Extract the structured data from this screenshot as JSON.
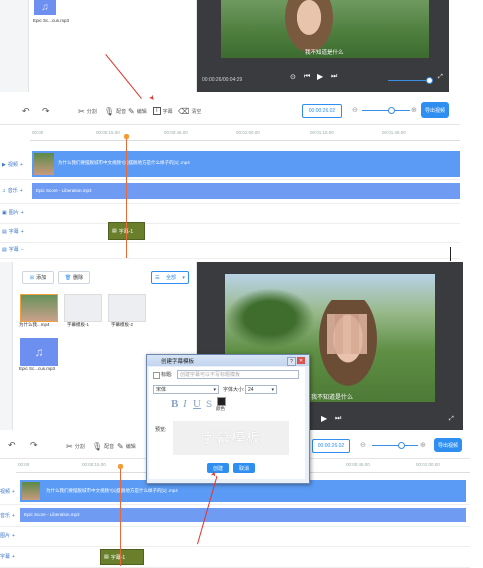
{
  "top": {
    "media_item_label": "Epic Sc...cus.mp3",
    "preview_subtitle": "我不知道是什么",
    "time_display": "00:00:26/00:04:29",
    "toolbar": {
      "split_label": "分割",
      "voice_label": "配音",
      "edit_label": "编辑",
      "subtitle_label": "字幕",
      "clear_label": "清空",
      "time_value": "00:00:26.02",
      "export_label": "导出视频"
    },
    "ruler_ticks": [
      "00:00",
      "00:00:15.00",
      "00:00:45.00",
      "00:01:00.00",
      "00:01:15.00",
      "00:01:45.00"
    ],
    "tracks": {
      "video_label": "视频",
      "music_label": "音乐",
      "image_label": "图片",
      "subtitle_label": "字幕",
      "subtitle2_label": "字幕",
      "video_clip_text": "为什么我们要摆脱城市中文视频?[1]摆脱地方是什么样子的[1] .mp4",
      "audio_clip_text": "Epic Score - Liberation.mp3",
      "subtitle_clip_text": "字幕-1"
    }
  },
  "bottom": {
    "add_label": "添加",
    "delete_label": "删除",
    "filter_label": "全部",
    "media": [
      {
        "label": "为什么我...mp4"
      },
      {
        "label": "字幕模板-1"
      },
      {
        "label": "字幕模板-2"
      },
      {
        "label": "Epic Sc...cus.mp3"
      }
    ],
    "toolbar": {
      "split_label": "分割",
      "voice_label": "配音",
      "edit_label": "编辑",
      "time_value": "00:00:26.02",
      "export_label": "导出视频"
    },
    "ruler_ticks": [
      "00:00",
      "00:00:15.00",
      "00:00:30.00",
      "00:00:45.00",
      "00:01:00.00"
    ],
    "tracks": {
      "video_label": "视频",
      "music_label": "音乐",
      "image_label": "图片",
      "subtitle_label": "字幕",
      "video_clip_text": "为什么我们要摆脱城市中文视频?[1]摆脱地方是什么样子的[1] .mp4",
      "audio_clip_text": "Epic Score - Liberation.mp3",
      "subtitle_clip_text": "字幕-1"
    },
    "preview_subtitle": "我不知道是什么"
  },
  "dialog": {
    "title": "创建字幕模板",
    "title_checkbox_label": "标题:",
    "title_placeholder": "创建字幕可以不写标题模板",
    "font_value": "宋体",
    "font_size_label": "字体大小:",
    "font_size_value": "24",
    "color_label": "颜色",
    "bold": "B",
    "italic": "I",
    "underline": "U",
    "strike": "S",
    "preview_label": "预览:",
    "preview_text": "字幕模板",
    "create_label": "创建",
    "cancel_label": "取消"
  },
  "colors": {
    "accent": "#2f8ff0",
    "arrow": "#e0332e",
    "video_clip": "#5b9bf5",
    "subtitle_clip": "#6a7f2c",
    "playhead": "#e86a3a"
  }
}
